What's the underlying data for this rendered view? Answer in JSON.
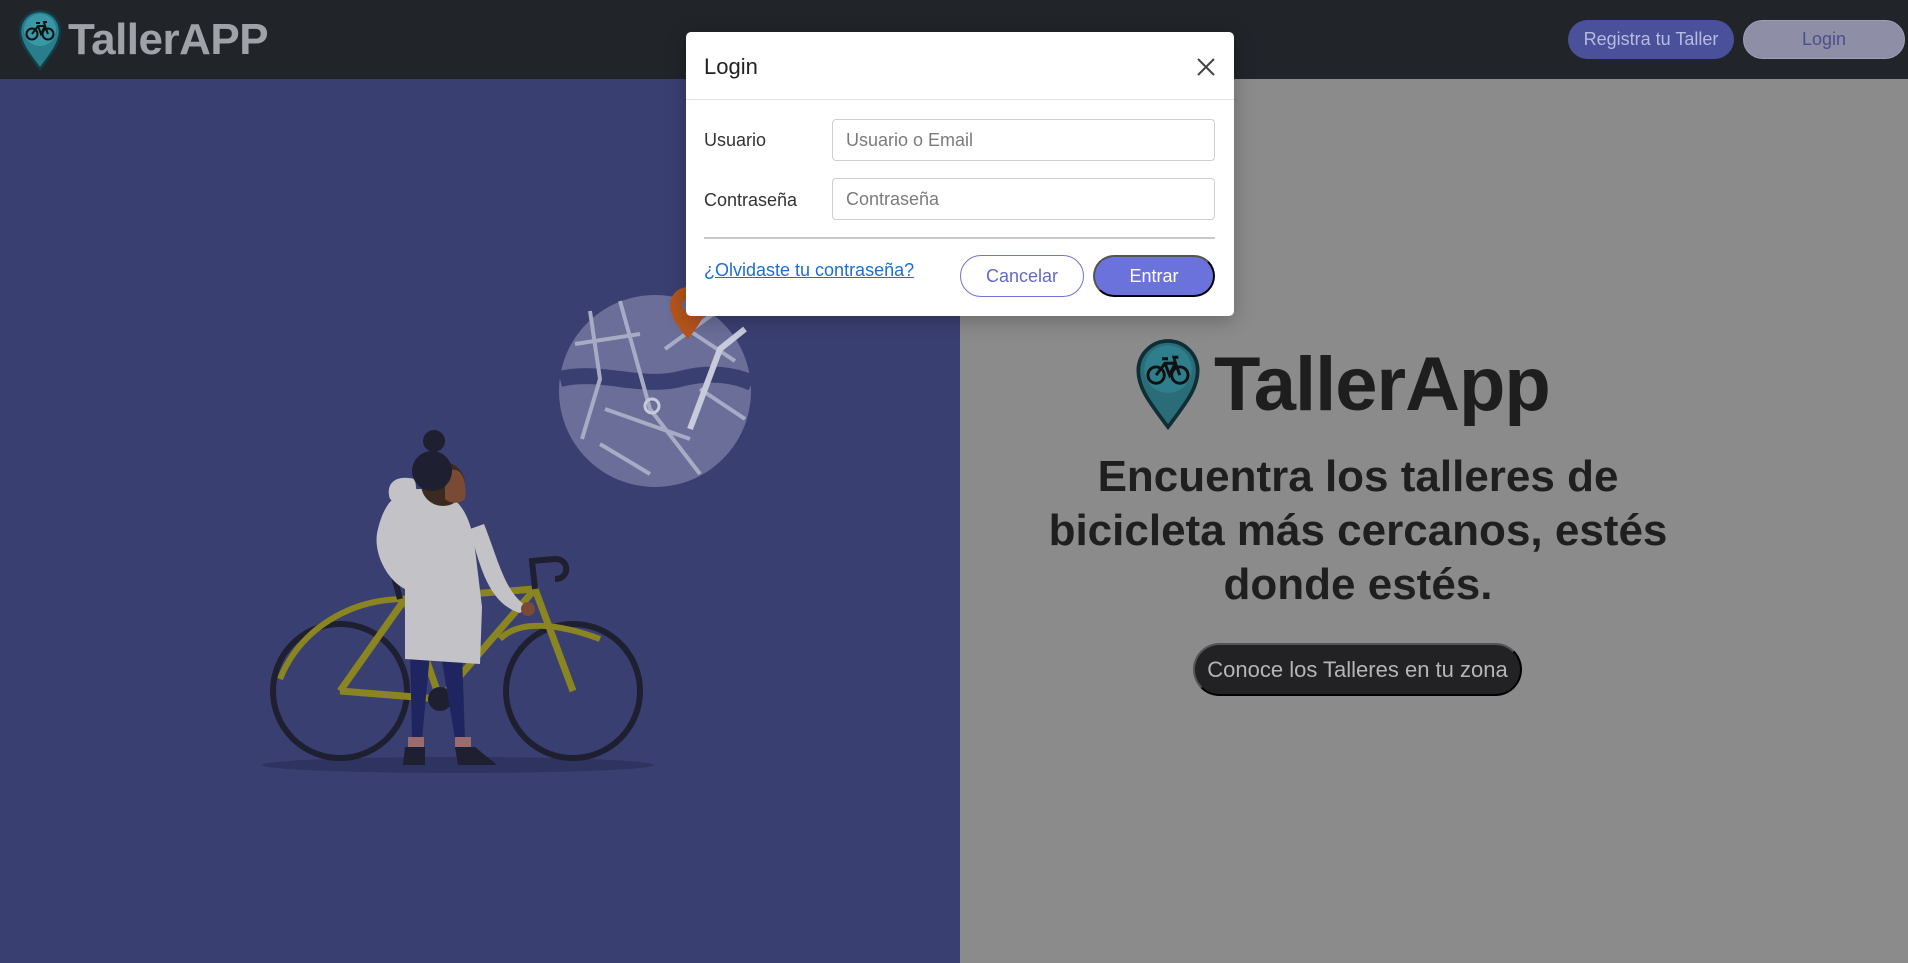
{
  "header": {
    "brand": "TallerAPP",
    "register_button": "Registra tu Taller",
    "login_button": "Login"
  },
  "hero": {
    "logo_text": "TallerApp",
    "title": "Encuentra los talleres de bicicleta más cercanos, estés donde estés.",
    "cta_button": "Conoce los Talleres en tu zona"
  },
  "modal": {
    "title": "Login",
    "user_label": "Usuario",
    "user_placeholder": "Usuario o Email",
    "user_value": "",
    "password_label": "Contraseña",
    "password_placeholder": "Contraseña",
    "password_value": "",
    "forgot_link": "¿Olvidaste tu contraseña?",
    "cancel_button": "Cancelar",
    "submit_button": "Entrar"
  },
  "icons": {
    "logo": "map-pin-bicycle-icon",
    "close": "close-icon"
  },
  "colors": {
    "header_bg": "#212429",
    "left_panel_bg": "#3a3f72",
    "right_panel_bg": "#8b8b8b",
    "accent": "#6c72db",
    "link": "#1b6ed6"
  }
}
